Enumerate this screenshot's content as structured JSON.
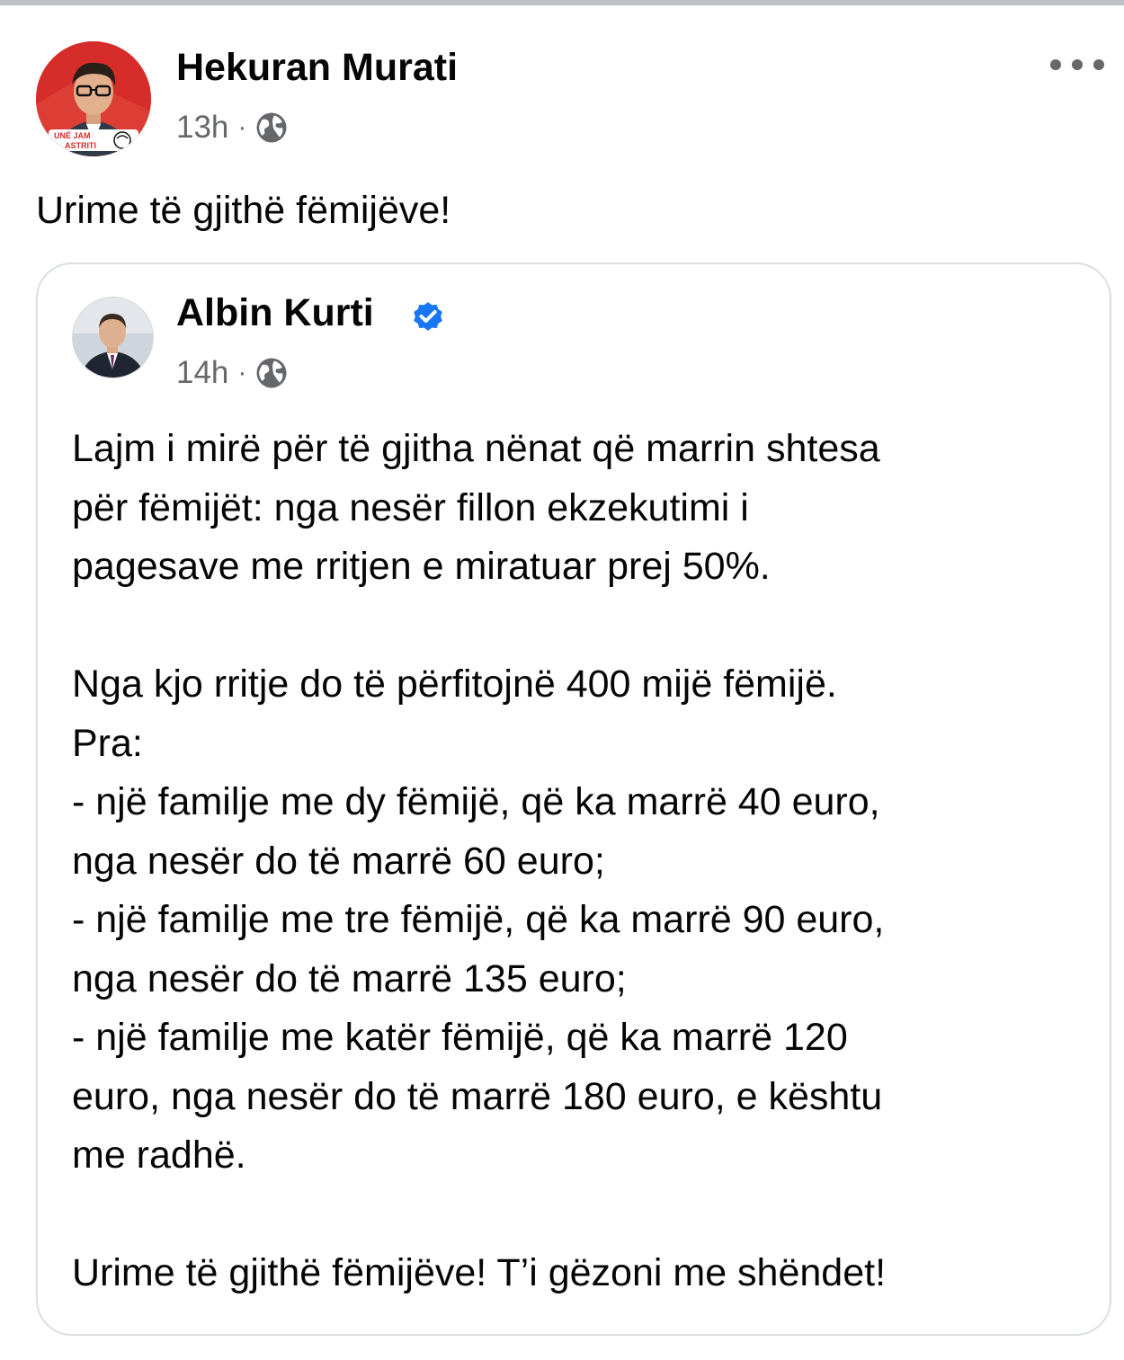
{
  "post": {
    "author": "Hekuran Murati",
    "time": "13h",
    "separator": "·",
    "text": "Urime të gjithë fëmijëve!",
    "avatar_badge": "UNË JAM ASTRITI"
  },
  "shared_post": {
    "author": "Albin Kurti",
    "verified": true,
    "time": "14h",
    "separator": "·",
    "paragraph_1": "Lajm i mirë për të gjitha nënat që marrin shtesa\npër fëmijët: nga nesër fillon ekzekutimi i\npagesave me rritjen e miratuar prej 50%.",
    "paragraph_2": "Nga kjo rritje do të përfitojnë 400 mijë fëmijë.\nPra:\n- një familje me dy fëmijë, që ka marrë 40 euro,\nnga nesër do të marrë 60 euro;\n- një familje me tre fëmijë, që ka marrë 90 euro,\nnga nesër do të marrë 135 euro;\n- një familje me katër fëmijë, që ka marrë 120\neuro, nga nesër do të marrë 180 euro, e kështu\nme radhë.",
    "paragraph_3": "Urime të gjithë fëmijëve! T’i gëzoni me shëndet!"
  },
  "colors": {
    "text": "#050505",
    "secondary": "#65676b",
    "verified": "#1877f2",
    "card_border": "#dadde1"
  },
  "icons": {
    "privacy": "globe-icon",
    "menu": "more-options-icon",
    "badge": "verified-badge-icon"
  }
}
